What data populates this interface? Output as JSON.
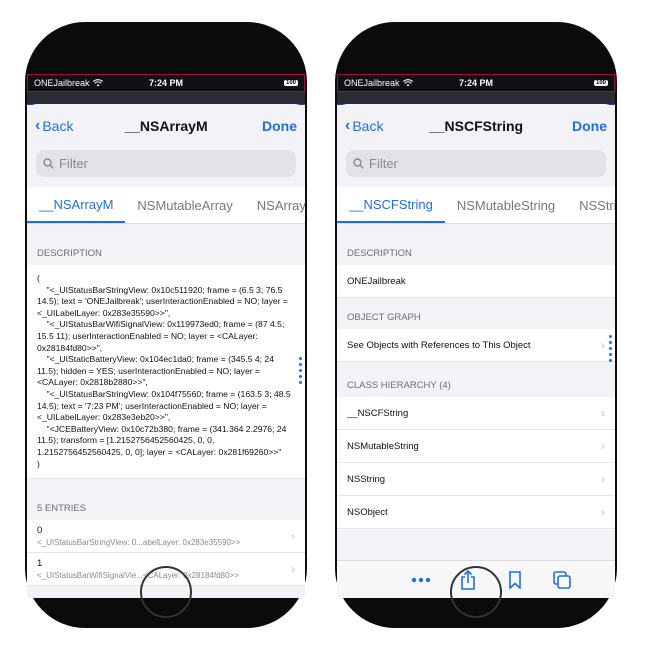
{
  "left": {
    "status": {
      "carrier": "ONEJailbreak",
      "time": "7:24 PM",
      "battery": "100"
    },
    "nav": {
      "back_label": "Back",
      "title": "__NSArrayM",
      "done_label": "Done"
    },
    "search": {
      "placeholder": "Filter"
    },
    "tabs": [
      "__NSArrayM",
      "NSMutableArray",
      "NSArray"
    ],
    "description": {
      "header": "DESCRIPTION",
      "text": "(\n    \"<_UIStatusBarStringView: 0x10c511920; frame = (6.5 3; 76.5 14.5); text = 'ONEJailbreak'; userInteractionEnabled = NO; layer = <_UILabelLayer: 0x283e35590>>\",\n    \"<_UIStatusBarWifiSignalView: 0x119973ed0; frame = (87 4.5; 15.5 11); userInteractionEnabled = NO; layer = <CALayer: 0x28184fd80>>\",\n    \"<_UIStaticBatteryView: 0x104ec1da0; frame = (345.5 4; 24 11.5); hidden = YES; userInteractionEnabled = NO; layer = <CALayer: 0x2818b2880>>\",\n    \"<_UIStatusBarStringView: 0x104f75560; frame = (163.5 3; 48.5 14.5); text = '7:23 PM'; userInteractionEnabled = NO; layer = <_UILabelLayer: 0x283e3eb20>>\",\n    \"<JCEBatteryView: 0x10c72b380; frame = (341.364 2.2976; 24 11.5); transform = [1.2152756452560425, 0, 0, 1.2152756452560425, 0, 0]; layer = <CALayer: 0x281f69260>>\"\n)"
    },
    "entries": {
      "header": "5 ENTRIES",
      "items": [
        {
          "index": "0",
          "value": "<_UIStatusBarStringView: 0...abelLayer: 0x283e35590>>"
        },
        {
          "index": "1",
          "value": "<_UIStatusBarWifiSignalVie...<CALayer: 0x28184fd80>>"
        }
      ]
    }
  },
  "right": {
    "status": {
      "carrier": "ONEJailbreak",
      "time": "7:24 PM",
      "battery": "100"
    },
    "nav": {
      "back_label": "Back",
      "title": "__NSCFString",
      "done_label": "Done"
    },
    "search": {
      "placeholder": "Filter"
    },
    "tabs": [
      "__NSCFString",
      "NSMutableString",
      "NSString"
    ],
    "description": {
      "header": "DESCRIPTION",
      "value": "ONEJailbreak"
    },
    "object_graph": {
      "header": "OBJECT GRAPH",
      "item": "See Objects with References to This Object"
    },
    "class_hierarchy": {
      "header": "CLASS HIERARCHY (4)",
      "items": [
        "__NSCFString",
        "NSMutableString",
        "NSString",
        "NSObject"
      ]
    },
    "toolbar": {
      "icons": [
        "more-icon",
        "share-icon",
        "bookmark-icon",
        "tabs-icon"
      ]
    }
  },
  "colors": {
    "accent": "#1f6fe0",
    "background": "#f2f2f7"
  }
}
